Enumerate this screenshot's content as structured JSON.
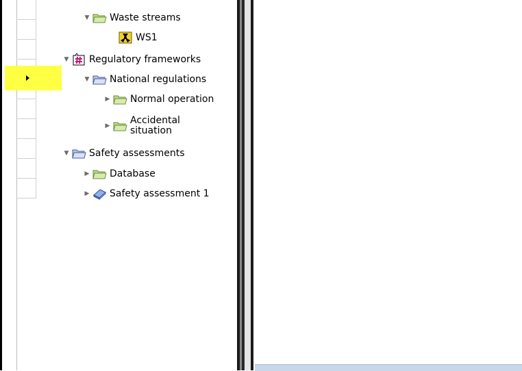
{
  "tree": {
    "waste_streams": {
      "label": "Waste streams",
      "icon": "folder-icon"
    },
    "ws1": {
      "label": "WS1",
      "icon": "radiation-icon"
    },
    "regulatory_frameworks": {
      "label": "Regulatory frameworks",
      "icon": "regulation-icon"
    },
    "national_regulations": {
      "label": "National regulations",
      "icon": "folder-icon"
    },
    "normal_operation": {
      "label": "Normal operation",
      "icon": "folder-icon"
    },
    "accidental_situation": {
      "label": "Accidental situation",
      "icon": "folder-icon"
    },
    "safety_assessments": {
      "label": "Safety assessments",
      "icon": "folder-icon"
    },
    "database": {
      "label": "Database",
      "icon": "folder-icon"
    },
    "safety_assessment_1": {
      "label": "Safety assessment 1",
      "icon": "book-icon"
    }
  },
  "colors": {
    "highlight": "#ffff44",
    "folder_green": "#b9d986",
    "folder_blue": "#b7c4e6",
    "book_blue": "#5a7fc8"
  }
}
